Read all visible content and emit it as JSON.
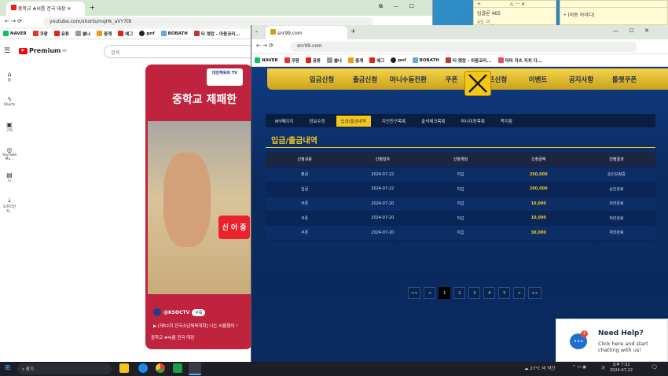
{
  "back_window": {
    "tab_title": "중학교 #씨름 전국 대장",
    "url": "youtube.com/shorts/mqHk_aVY7t8",
    "bookmarks": [
      "NAVER",
      "쿠팡",
      "유튜",
      "쏠나",
      "중계",
      "에그",
      "pnf",
      "BOBATH",
      "티 렛캉 - 아동코리...",
      "마마"
    ],
    "yt_logo": "Premium",
    "yt_country": "KR",
    "search_placeholder": "검색",
    "nav": [
      "홈",
      "Shorts",
      "구독",
      "YouTube Mu...",
      "나",
      "오프라인 저..."
    ],
    "short": {
      "channel_badge": "대한체육회 TV",
      "headline": "중학교 제패한",
      "overlay_text": "신 어 중",
      "channel": "@KSOCTV",
      "subscribe": "구독",
      "caption": "▶ [제52회 전국소년체육대회] 나는 씨름왕이 !",
      "tagline": "중학교 #씨름 전국 대장"
    }
  },
  "front_window": {
    "url": "snr99.com",
    "bookmarks": [
      "NAVER",
      "쿠팡",
      "유튜",
      "쏠나",
      "중계",
      "에그",
      "pnf",
      "BOBATH",
      "티 렛캉 - 아동코리...",
      "마마 카츠 자치 다..."
    ],
    "topnav": [
      "입금신청",
      "출금신청",
      "머니수동전환",
      "쿠폰",
      "콤프신청",
      "이벤트",
      "공지사항",
      "룰렛쿠폰"
    ],
    "subtabs": [
      "MY페이지",
      "정보수정",
      "입금/출금내역",
      "지인친구목록",
      "출석체크목록",
      "머니이동목록",
      "쪽지함"
    ],
    "active_subtab": "입금/출금내역",
    "title": "입금/출금내역",
    "table": {
      "headers": [
        "신청내용",
        "신청일자",
        "신청게임",
        "신청금액",
        "진행결과"
      ],
      "rows": [
        [
          "출금",
          "2024-07-22",
          "지갑",
          "250,000",
          "승인요청중"
        ],
        [
          "입금",
          "2024-07-22",
          "지갑",
          "200,000",
          "승인완료"
        ],
        [
          "쿠폰",
          "2024-07-20",
          "지갑",
          "10,000",
          "처리완료"
        ],
        [
          "쿠폰",
          "2024-07-20",
          "지갑",
          "10,000",
          "처리완료"
        ],
        [
          "쿠폰",
          "2024-07-20",
          "지갑",
          "30,000",
          "처리완료"
        ]
      ]
    },
    "pager": [
      "<<",
      "<",
      "1",
      "2",
      "3",
      "4",
      "5",
      ">",
      ">>"
    ],
    "current_page": "1"
  },
  "help_widget": {
    "title": "Need Help?",
    "body": "Click here and start chatting with us!",
    "badge": "1"
  },
  "desktop_notes": {
    "note1": "입결론 465",
    "note1b": "4도 이 _",
    "note2": "• (아동 아이디)"
  },
  "taskbar": {
    "search": "찾기",
    "weather": "27°C 비 약간",
    "time": "오후 7:32",
    "date": "2024-07-22",
    "lang": "가"
  }
}
